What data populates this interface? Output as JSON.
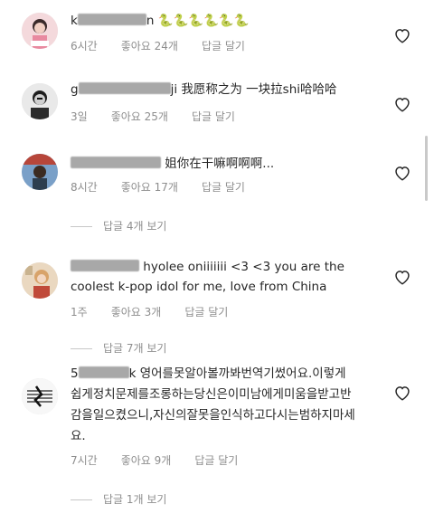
{
  "comments": [
    {
      "name_prefix": "k",
      "name_suffix": "n",
      "text": "🐍🐍🐍🐍🐍🐍",
      "time": "6시간",
      "likes": "좋아요 24개",
      "reply": "답글 달기"
    },
    {
      "name_prefix": "g",
      "name_suffix": "ji",
      "text": "我愿称之为  一块拉shi哈哈哈",
      "time": "3일",
      "likes": "좋아요 25개",
      "reply": "답글 달기"
    },
    {
      "name_prefix": "",
      "name_suffix": "",
      "text": "姐你在干嘛啊啊啊...",
      "time": "8시간",
      "likes": "좋아요 17개",
      "reply": "답글 달기",
      "view_replies": "답글 4개 보기"
    },
    {
      "name_prefix": "",
      "name_suffix": "",
      "text_line1": "hyolee oniiiiiii <3 <3 you are the",
      "text_line2": "coolest k-pop idol for me, love from China",
      "time": "1주",
      "likes": "좋아요 3개",
      "reply": "답글 달기",
      "view_replies": "답글 7개 보기"
    },
    {
      "name_prefix": "5",
      "name_suffix": "k",
      "text_line1": "영어를못알아볼까봐번역기썼어요.이렇게",
      "text_line2": "쉽게정치문제를조롱하는당신은이미남에게미움을받고반",
      "text_line3": "감을일으켰으니,자신의잘못을인식하고다시는범하지마세",
      "text_line4": "요.",
      "time": "7시간",
      "likes": "좋아요 9개",
      "reply": "답글 달기",
      "view_replies": "답글 1개 보기"
    }
  ],
  "icons": {
    "heart": "heart-outline-icon"
  },
  "colors": {
    "text": "#262626",
    "meta": "#8e8e8e",
    "redacted": "#a8a8a8"
  }
}
